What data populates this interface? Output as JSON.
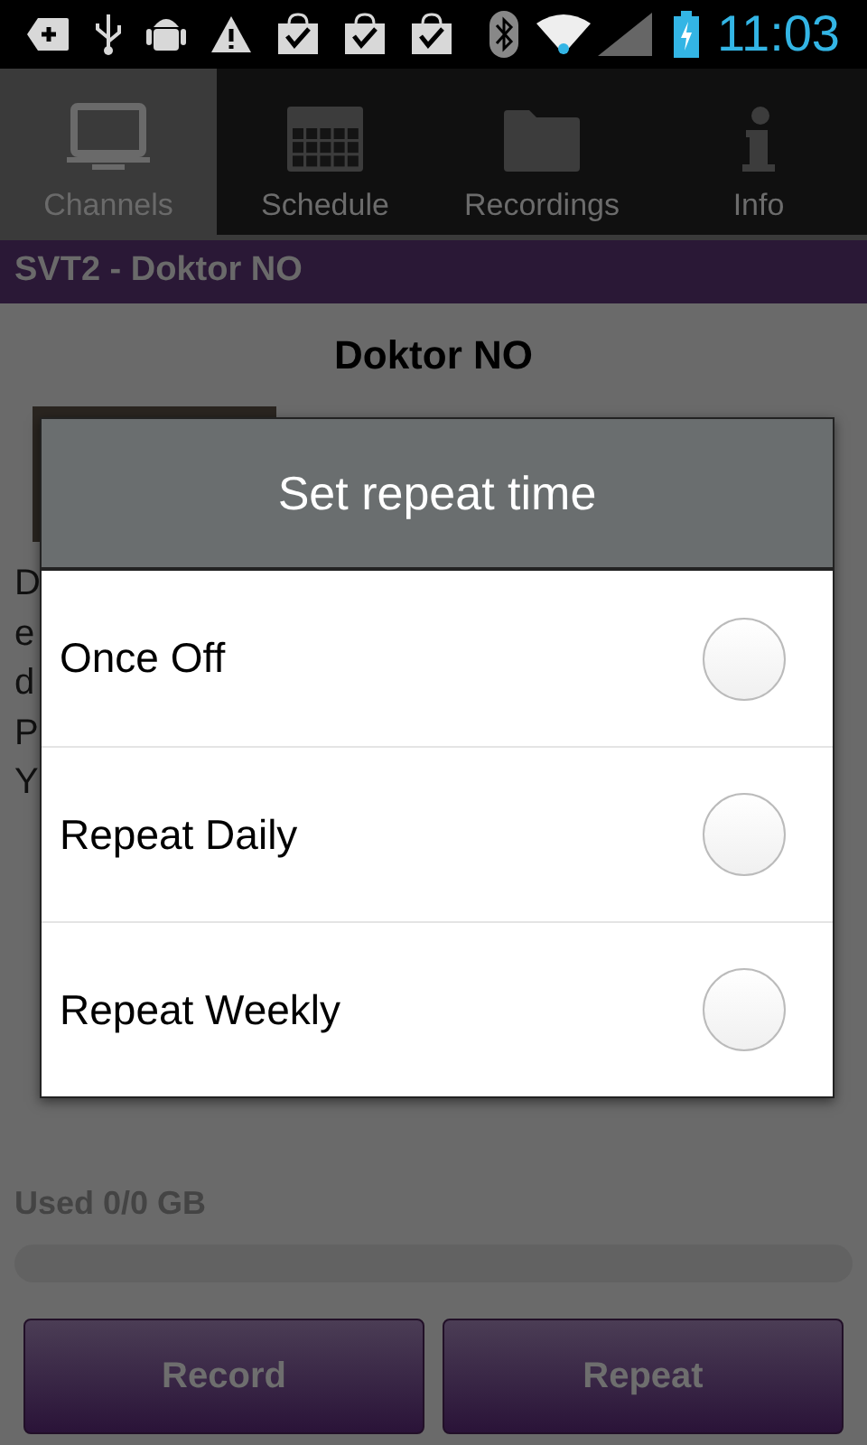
{
  "status_bar": {
    "time": "11:03"
  },
  "tabs": [
    {
      "label": "Channels",
      "selected": true
    },
    {
      "label": "Schedule",
      "selected": false
    },
    {
      "label": "Recordings",
      "selected": false
    },
    {
      "label": "Info",
      "selected": false
    }
  ],
  "header": {
    "title": "SVT2 - Doktor NO"
  },
  "program": {
    "title": "Doktor NO",
    "description_fragments": [
      "D",
      "e",
      "d",
      "P",
      "Y"
    ]
  },
  "storage": {
    "label": "Used 0/0 GB",
    "level": 0
  },
  "buttons": [
    "Record",
    "Repeat"
  ],
  "dialog": {
    "title": "Set repeat time",
    "options": [
      {
        "label": "Once Off",
        "selected": false
      },
      {
        "label": "Repeat Daily",
        "selected": false
      },
      {
        "label": "Repeat Weekly",
        "selected": false
      }
    ]
  }
}
